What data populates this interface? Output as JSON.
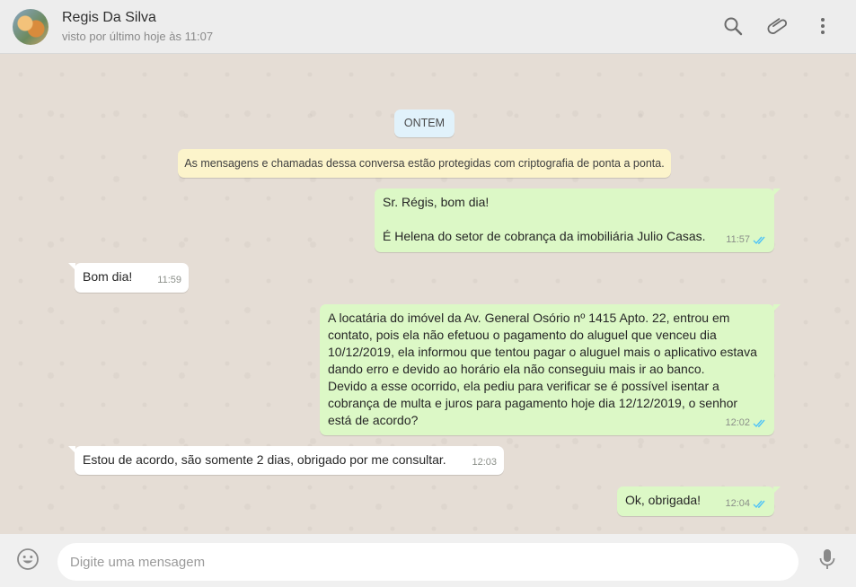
{
  "header": {
    "contact_name": "Regis Da Silva",
    "status": "visto por último hoje às 11:07",
    "icons": [
      "search-icon",
      "attach-icon",
      "menu-icon"
    ]
  },
  "chat": {
    "day_label": "ONTEM",
    "system_message": "As mensagens e chamadas dessa conversa estão protegidas com criptografia de ponta a ponta.",
    "messages": [
      {
        "direction": "out",
        "text": "Sr. Régis, bom dia!\n\nÉ Helena do setor de cobrança da imobiliária Julio Casas.",
        "time": "11:57",
        "read": true
      },
      {
        "direction": "in",
        "text": "Bom dia!",
        "time": "11:59"
      },
      {
        "direction": "out",
        "text": "A locatária do imóvel da Av. General Osório nº 1415 Apto. 22, entrou em\ncontato, pois ela não efetuou o pagamento do aluguel que venceu dia\n10/12/2019, ela informou que tentou pagar o aluguel mais o aplicativo estava\ndando erro e devido ao horário ela não conseguiu mais ir ao banco.\nDevido a esse ocorrido, ela pediu para verificar se é possível isentar a\ncobrança de multa e juros para pagamento hoje dia 12/12/2019, o senhor\nestá de acordo?",
        "time": "12:02",
        "read": true
      },
      {
        "direction": "in",
        "text": "Estou de acordo, são somente 2 dias, obrigado por me consultar.",
        "time": "12:03"
      },
      {
        "direction": "out",
        "text": "Ok, obrigada!",
        "time": "12:04",
        "read": true
      }
    ]
  },
  "footer": {
    "input_placeholder": "Digite uma mensagem",
    "input_value": ""
  },
  "colors": {
    "outgoing_bubble": "#dcf8c6",
    "incoming_bubble": "#ffffff",
    "read_ticks": "#4fc3f7",
    "chat_background": "#e5ddd5"
  }
}
